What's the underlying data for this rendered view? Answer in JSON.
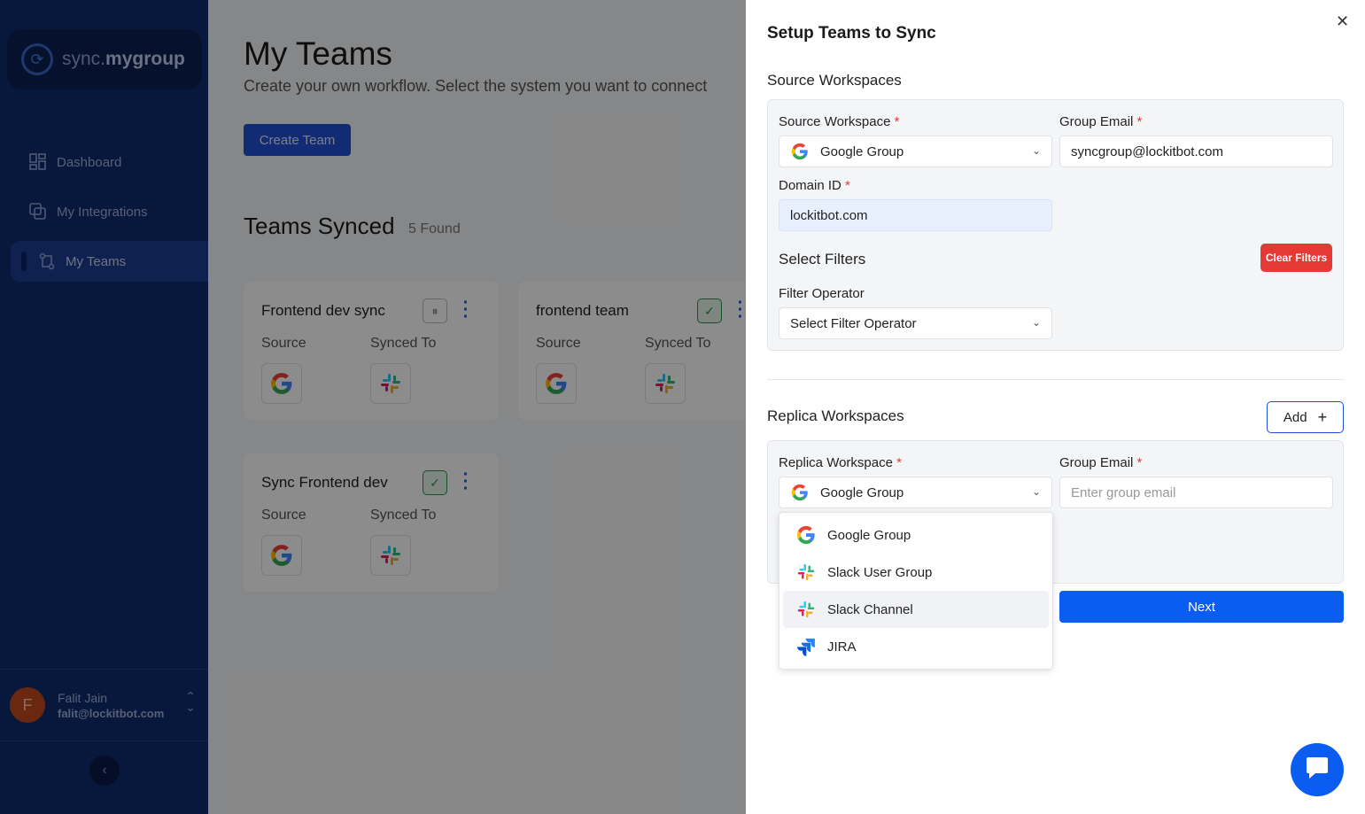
{
  "sidebar": {
    "logo": {
      "prefix": "sync.",
      "brand": "mygroup"
    },
    "items": [
      {
        "label": "Dashboard",
        "icon": "dashboard-icon"
      },
      {
        "label": "My Integrations",
        "icon": "integrations-icon"
      },
      {
        "label": "My Teams",
        "icon": "teams-icon",
        "active": true
      }
    ],
    "user": {
      "initial": "F",
      "name": "Falit Jain",
      "email": "falit@lockitbot.com"
    }
  },
  "main": {
    "title": "My Teams",
    "subtitle": "Create your own workflow. Select the system you want to connect",
    "create_button": "Create Team",
    "synced_title": "Teams Synced",
    "synced_count": "5 Found",
    "source_label": "Source",
    "synced_to_label": "Synced To",
    "teams": [
      {
        "name": "Frontend dev sync",
        "status": "paused"
      },
      {
        "name": "frontend team",
        "status": "active"
      },
      {
        "name": "Sync Frontend dev",
        "status": "active"
      }
    ]
  },
  "drawer": {
    "title": "Setup Teams to Sync",
    "source": {
      "section_title": "Source Workspaces",
      "workspace_label": "Source Workspace",
      "workspace_value": "Google Group",
      "email_label": "Group Email",
      "email_value": "syncgroup@lockitbot.com",
      "domain_label": "Domain ID",
      "domain_value": "lockitbot.com",
      "filters_title": "Select Filters",
      "clear_filters": "Clear Filters",
      "operator_label": "Filter Operator",
      "operator_value": "Select Filter Operator"
    },
    "replica": {
      "section_title": "Replica Workspaces",
      "add_button": "Add",
      "workspace_label": "Replica Workspace",
      "workspace_value": "Google Group",
      "email_label": "Group Email",
      "email_placeholder": "Enter group email",
      "options": [
        {
          "label": "Google Group",
          "icon": "google-icon"
        },
        {
          "label": "Slack User Group",
          "icon": "slack-icon"
        },
        {
          "label": "Slack Channel",
          "icon": "slack-icon",
          "highlighted": true
        },
        {
          "label": "JIRA",
          "icon": "jira-icon"
        }
      ]
    },
    "next_button": "Next",
    "required_mark": "*"
  },
  "colors": {
    "primary": "#0b5cf0",
    "sidebar": "#0f2a6e",
    "danger": "#e53935"
  }
}
